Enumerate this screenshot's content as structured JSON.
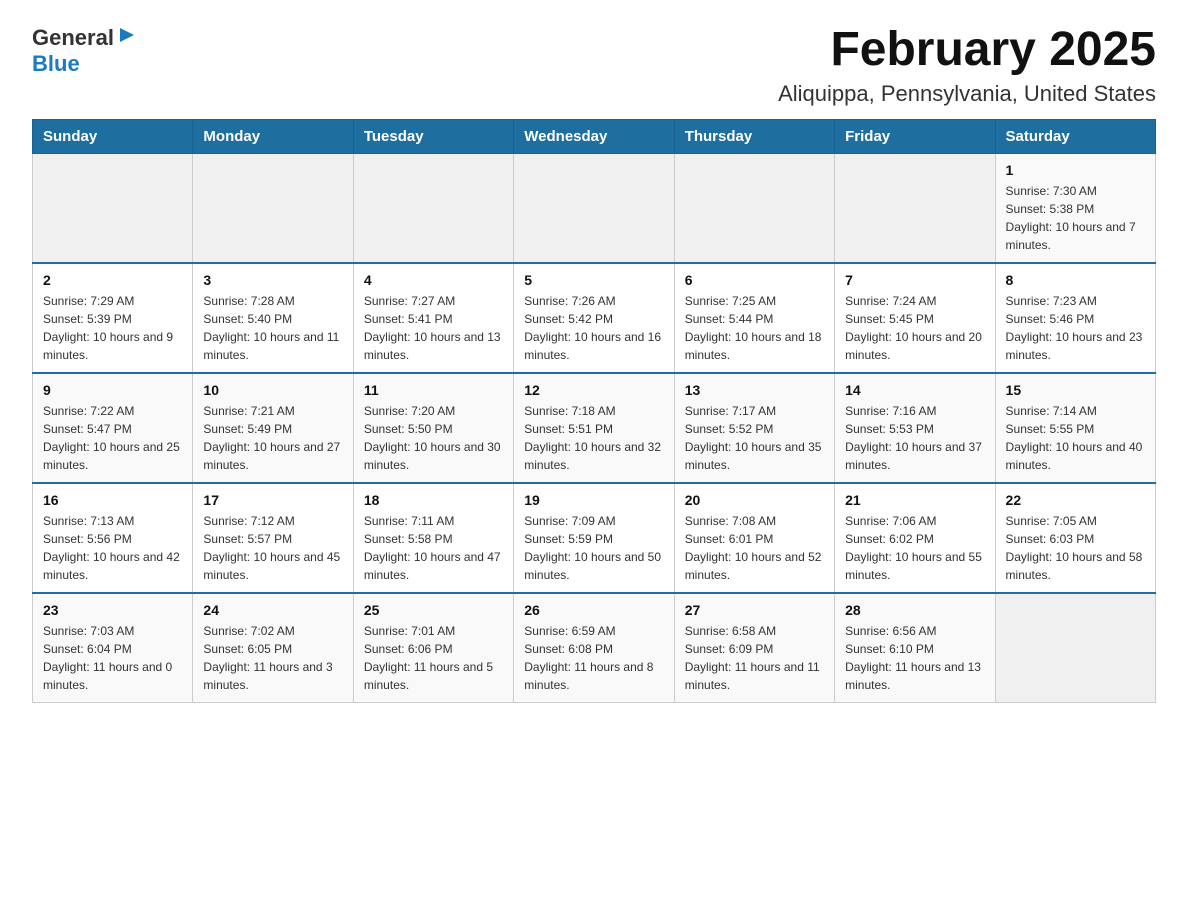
{
  "header": {
    "logo_general": "General",
    "logo_blue": "Blue",
    "title": "February 2025",
    "subtitle": "Aliquippa, Pennsylvania, United States"
  },
  "weekdays": [
    "Sunday",
    "Monday",
    "Tuesday",
    "Wednesday",
    "Thursday",
    "Friday",
    "Saturday"
  ],
  "weeks": [
    [
      {
        "day": "",
        "sunrise": "",
        "sunset": "",
        "daylight": ""
      },
      {
        "day": "",
        "sunrise": "",
        "sunset": "",
        "daylight": ""
      },
      {
        "day": "",
        "sunrise": "",
        "sunset": "",
        "daylight": ""
      },
      {
        "day": "",
        "sunrise": "",
        "sunset": "",
        "daylight": ""
      },
      {
        "day": "",
        "sunrise": "",
        "sunset": "",
        "daylight": ""
      },
      {
        "day": "",
        "sunrise": "",
        "sunset": "",
        "daylight": ""
      },
      {
        "day": "1",
        "sunrise": "Sunrise: 7:30 AM",
        "sunset": "Sunset: 5:38 PM",
        "daylight": "Daylight: 10 hours and 7 minutes."
      }
    ],
    [
      {
        "day": "2",
        "sunrise": "Sunrise: 7:29 AM",
        "sunset": "Sunset: 5:39 PM",
        "daylight": "Daylight: 10 hours and 9 minutes."
      },
      {
        "day": "3",
        "sunrise": "Sunrise: 7:28 AM",
        "sunset": "Sunset: 5:40 PM",
        "daylight": "Daylight: 10 hours and 11 minutes."
      },
      {
        "day": "4",
        "sunrise": "Sunrise: 7:27 AM",
        "sunset": "Sunset: 5:41 PM",
        "daylight": "Daylight: 10 hours and 13 minutes."
      },
      {
        "day": "5",
        "sunrise": "Sunrise: 7:26 AM",
        "sunset": "Sunset: 5:42 PM",
        "daylight": "Daylight: 10 hours and 16 minutes."
      },
      {
        "day": "6",
        "sunrise": "Sunrise: 7:25 AM",
        "sunset": "Sunset: 5:44 PM",
        "daylight": "Daylight: 10 hours and 18 minutes."
      },
      {
        "day": "7",
        "sunrise": "Sunrise: 7:24 AM",
        "sunset": "Sunset: 5:45 PM",
        "daylight": "Daylight: 10 hours and 20 minutes."
      },
      {
        "day": "8",
        "sunrise": "Sunrise: 7:23 AM",
        "sunset": "Sunset: 5:46 PM",
        "daylight": "Daylight: 10 hours and 23 minutes."
      }
    ],
    [
      {
        "day": "9",
        "sunrise": "Sunrise: 7:22 AM",
        "sunset": "Sunset: 5:47 PM",
        "daylight": "Daylight: 10 hours and 25 minutes."
      },
      {
        "day": "10",
        "sunrise": "Sunrise: 7:21 AM",
        "sunset": "Sunset: 5:49 PM",
        "daylight": "Daylight: 10 hours and 27 minutes."
      },
      {
        "day": "11",
        "sunrise": "Sunrise: 7:20 AM",
        "sunset": "Sunset: 5:50 PM",
        "daylight": "Daylight: 10 hours and 30 minutes."
      },
      {
        "day": "12",
        "sunrise": "Sunrise: 7:18 AM",
        "sunset": "Sunset: 5:51 PM",
        "daylight": "Daylight: 10 hours and 32 minutes."
      },
      {
        "day": "13",
        "sunrise": "Sunrise: 7:17 AM",
        "sunset": "Sunset: 5:52 PM",
        "daylight": "Daylight: 10 hours and 35 minutes."
      },
      {
        "day": "14",
        "sunrise": "Sunrise: 7:16 AM",
        "sunset": "Sunset: 5:53 PM",
        "daylight": "Daylight: 10 hours and 37 minutes."
      },
      {
        "day": "15",
        "sunrise": "Sunrise: 7:14 AM",
        "sunset": "Sunset: 5:55 PM",
        "daylight": "Daylight: 10 hours and 40 minutes."
      }
    ],
    [
      {
        "day": "16",
        "sunrise": "Sunrise: 7:13 AM",
        "sunset": "Sunset: 5:56 PM",
        "daylight": "Daylight: 10 hours and 42 minutes."
      },
      {
        "day": "17",
        "sunrise": "Sunrise: 7:12 AM",
        "sunset": "Sunset: 5:57 PM",
        "daylight": "Daylight: 10 hours and 45 minutes."
      },
      {
        "day": "18",
        "sunrise": "Sunrise: 7:11 AM",
        "sunset": "Sunset: 5:58 PM",
        "daylight": "Daylight: 10 hours and 47 minutes."
      },
      {
        "day": "19",
        "sunrise": "Sunrise: 7:09 AM",
        "sunset": "Sunset: 5:59 PM",
        "daylight": "Daylight: 10 hours and 50 minutes."
      },
      {
        "day": "20",
        "sunrise": "Sunrise: 7:08 AM",
        "sunset": "Sunset: 6:01 PM",
        "daylight": "Daylight: 10 hours and 52 minutes."
      },
      {
        "day": "21",
        "sunrise": "Sunrise: 7:06 AM",
        "sunset": "Sunset: 6:02 PM",
        "daylight": "Daylight: 10 hours and 55 minutes."
      },
      {
        "day": "22",
        "sunrise": "Sunrise: 7:05 AM",
        "sunset": "Sunset: 6:03 PM",
        "daylight": "Daylight: 10 hours and 58 minutes."
      }
    ],
    [
      {
        "day": "23",
        "sunrise": "Sunrise: 7:03 AM",
        "sunset": "Sunset: 6:04 PM",
        "daylight": "Daylight: 11 hours and 0 minutes."
      },
      {
        "day": "24",
        "sunrise": "Sunrise: 7:02 AM",
        "sunset": "Sunset: 6:05 PM",
        "daylight": "Daylight: 11 hours and 3 minutes."
      },
      {
        "day": "25",
        "sunrise": "Sunrise: 7:01 AM",
        "sunset": "Sunset: 6:06 PM",
        "daylight": "Daylight: 11 hours and 5 minutes."
      },
      {
        "day": "26",
        "sunrise": "Sunrise: 6:59 AM",
        "sunset": "Sunset: 6:08 PM",
        "daylight": "Daylight: 11 hours and 8 minutes."
      },
      {
        "day": "27",
        "sunrise": "Sunrise: 6:58 AM",
        "sunset": "Sunset: 6:09 PM",
        "daylight": "Daylight: 11 hours and 11 minutes."
      },
      {
        "day": "28",
        "sunrise": "Sunrise: 6:56 AM",
        "sunset": "Sunset: 6:10 PM",
        "daylight": "Daylight: 11 hours and 13 minutes."
      },
      {
        "day": "",
        "sunrise": "",
        "sunset": "",
        "daylight": ""
      }
    ]
  ]
}
